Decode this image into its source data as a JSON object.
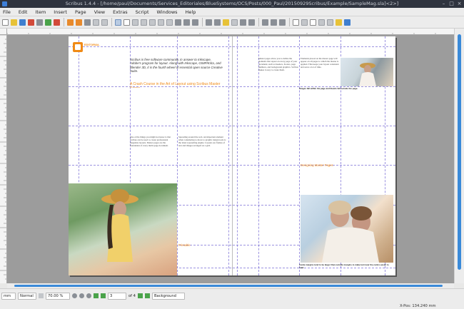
{
  "window": {
    "title": "Scribus 1.4.4 - [/home/paul/Documents/Services_Editoriales/BlueSystems/OCS/Posts/000_Paul/20150929Scribus/Example/SampleMag.sla]<2>]",
    "controls": [
      "–",
      "□",
      "×"
    ]
  },
  "menu": [
    "File",
    "Edit",
    "Item",
    "Insert",
    "Page",
    "View",
    "Extras",
    "Script",
    "Windows",
    "Help"
  ],
  "toolbar_icons": [
    "new-icon",
    "open-icon",
    "save-icon",
    "close-icon",
    "print-icon",
    "preflight-icon",
    "pdf-icon",
    "undo-icon",
    "redo-icon",
    "cut-icon",
    "copy-icon",
    "paste-icon",
    "select-icon",
    "text-frame-icon",
    "image-frame-icon",
    "render-frame-icon",
    "table-icon",
    "shape-icon",
    "polygon-icon",
    "line-icon",
    "bezier-icon",
    "freehand-icon",
    "rotate-icon",
    "zoom-icon",
    "edit-text-icon",
    "story-editor-icon",
    "link-frames-icon",
    "unlink-frames-icon",
    "measure-icon",
    "copy-props-icon",
    "eyedropper-icon",
    "pdf-push-button-icon",
    "pdf-text-field-icon",
    "pdf-checkbox-icon",
    "pdf-combo-icon",
    "pdf-list-icon",
    "pdf-annotation-icon",
    "pdf-link-icon"
  ],
  "page": {
    "brand": "EDITORIAL",
    "intro": "Scribus is free software community, in answer to Inkscape, Adobe's program for layout. Along with Inkscape, GIMP/Krita, and Blender 3D, it is the fourth wheel of essential open source Creative Suite.",
    "headline": "A Crash Course in the Art of Layout using Scribus Master Pages",
    "col1_text": "One of the things you might not know is that Scribus can be used to create professional magazine layouts. Master pages are the foundation of every multi-page document.",
    "col2_text": "Spreading around the web. An important element when considering to move to graphic design tools is the latest typesetting engine. Layouts are frames of text and images arranged on a grid.",
    "col3_text": "Master pages allow you to define the elements that repeat on every page of your document, such as headers, footers, page numbers, and background graphics. Scribus makes it easy to create them.",
    "col4_text": "Elements placed on the master page will appear on all pages to which the master is applied. This keeps your layout consistent and saves a lot of time.",
    "sub_heading_left": "Printable",
    "sub_heading_right": "Designing Master Pages",
    "caption_tr": "Images fall within the page and bleeds fall outside the page.",
    "caption_br": "Inside margins tend to be larger than outside margins to make text near the centre easier to read."
  },
  "status": {
    "unit": "mm",
    "mode": "Normal",
    "zoom": "70.00 %",
    "page_current": "3",
    "page_total": "of 4",
    "layer": "Background",
    "coords": "X-Pos: 134.240 mm"
  }
}
